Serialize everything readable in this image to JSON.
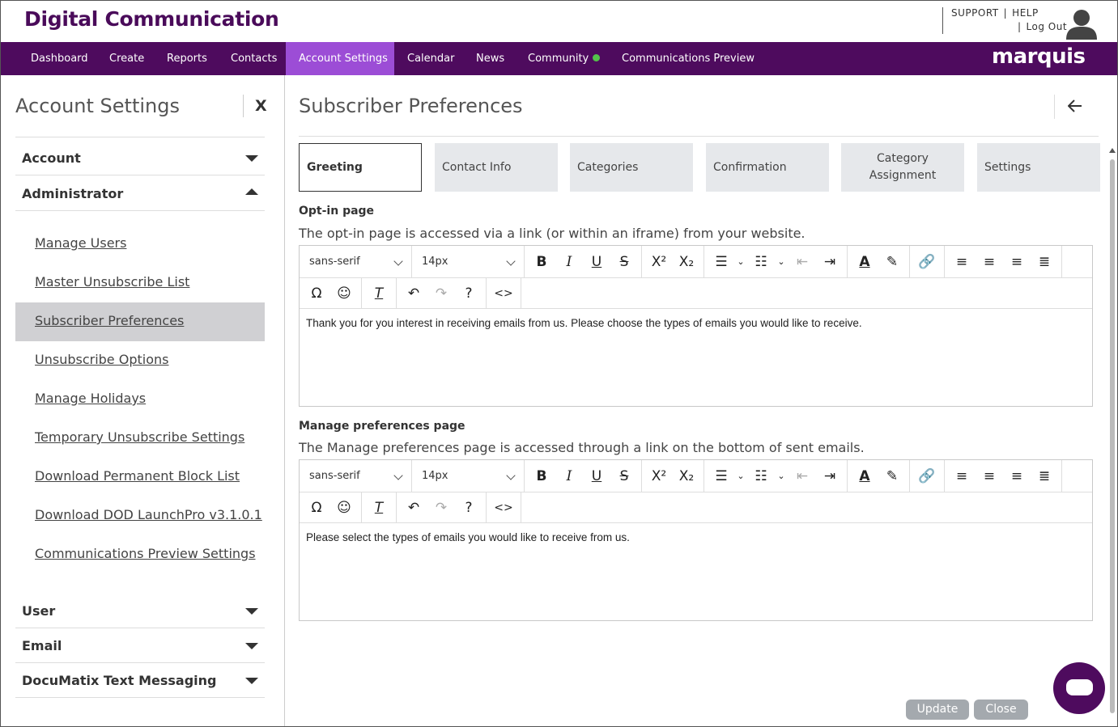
{
  "header": {
    "brand": "Digital Communication",
    "support": "SUPPORT",
    "sep1": "|",
    "help": "HELP",
    "sep2": "|",
    "logout": "Log Out"
  },
  "nav": {
    "items": [
      "Dashboard",
      "Create",
      "Reports",
      "Contacts",
      "Account Settings",
      "Calendar",
      "News",
      "Community",
      "Communications Preview"
    ],
    "active": "Account Settings",
    "logo": "marquis"
  },
  "sidebar": {
    "title": "Account Settings",
    "close": "X",
    "sections": {
      "account": "Account",
      "administrator": "Administrator",
      "user": "User",
      "email": "Email",
      "documatix": "DocuMatix Text Messaging"
    },
    "admin_items": [
      "Manage Users",
      "Master Unsubscribe List",
      "Subscriber Preferences",
      "Unsubscribe Options",
      "Manage Holidays",
      "Temporary Unsubscribe Settings",
      "Download Permanent Block List",
      "Download DOD LaunchPro v3.1.0.1",
      "Communications Preview Settings"
    ],
    "selected": "Subscriber Preferences"
  },
  "main": {
    "title": "Subscriber Preferences",
    "tabs": [
      "Greeting",
      "Contact Info",
      "Categories",
      "Confirmation",
      "Category Assignment",
      "Settings"
    ],
    "active_tab": "Greeting",
    "optin": {
      "label": "Opt-in page",
      "description": "The opt-in page is accessed via a link (or within an iframe) from your website.",
      "font": "sans-serif",
      "size": "14px",
      "content": "Thank you for you interest in receiving emails from us. Please choose the types of emails you would like to receive."
    },
    "manage": {
      "label": "Manage preferences page",
      "description": "The Manage preferences page is accessed through a link on the bottom of sent emails.",
      "font": "sans-serif",
      "size": "14px",
      "content": "Please select the types of emails you would like to receive from us."
    },
    "update": "Update",
    "close": "Close"
  },
  "colors": {
    "nav_bg": "#4e0b5e",
    "nav_active": "#9c4dd6",
    "brand": "#4a0b5a",
    "selected_bg": "#d0d0d3",
    "community_dot": "#54c24b"
  }
}
